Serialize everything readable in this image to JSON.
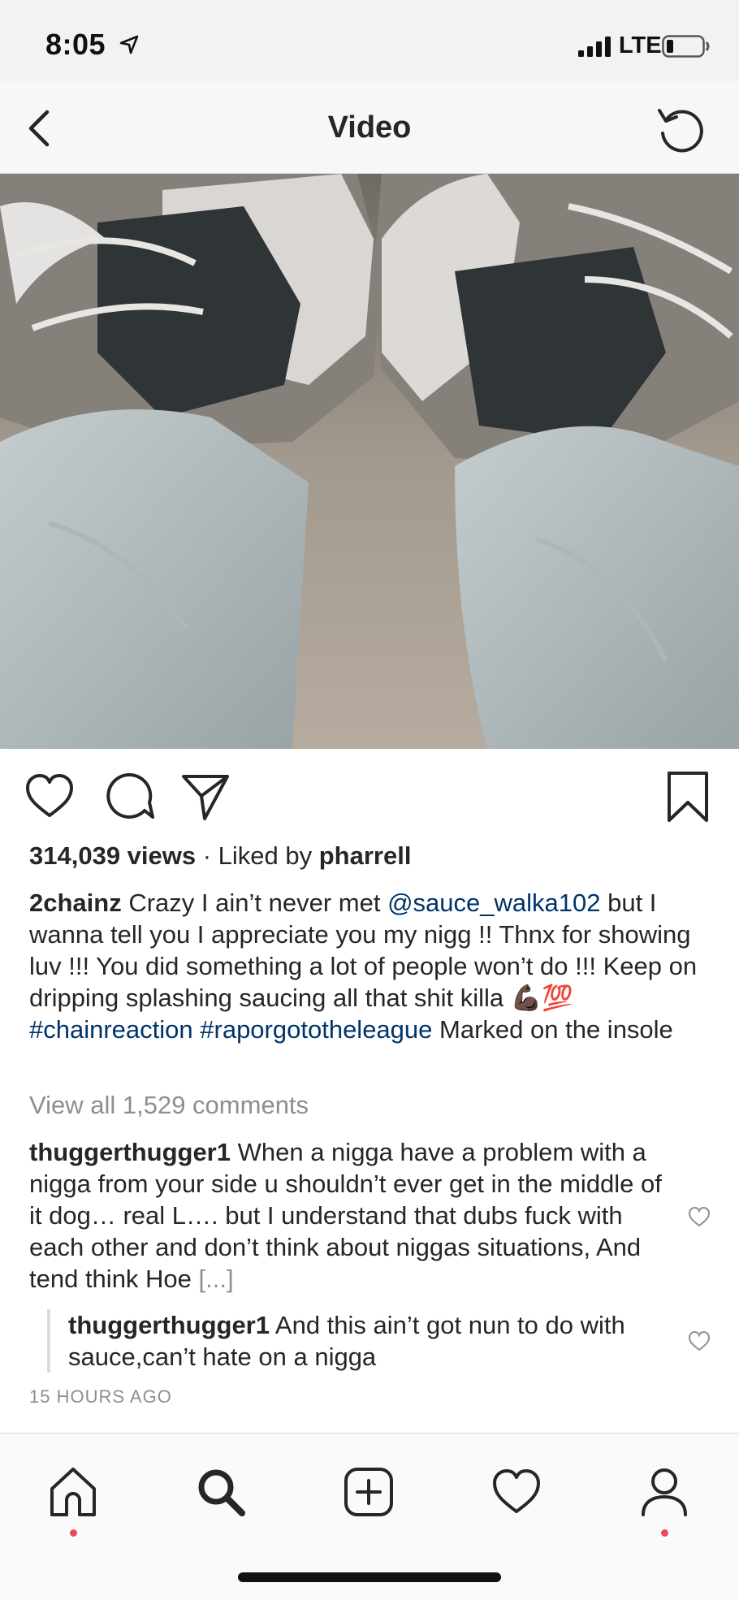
{
  "status_bar": {
    "time": "8:05",
    "network": "LTE",
    "icons": [
      "location-arrow-icon",
      "signal-bars-icon",
      "battery-icon"
    ]
  },
  "header": {
    "title": "Video",
    "back_icon": "chevron-left-icon",
    "refresh_icon": "refresh-icon"
  },
  "actions": {
    "icons": [
      "heart-icon",
      "comment-icon",
      "share-icon",
      "bookmark-icon"
    ]
  },
  "post": {
    "views": "314,039 views",
    "liked_by_prefix": " · Liked by ",
    "liked_by_user": "pharrell",
    "caption": {
      "user": "2chainz",
      "text_1": " Crazy I ain’t never met ",
      "mention": "@sauce_walka102",
      "text_2": " but I wanna tell you I appreciate you my nigg !! Thnx for showing luv !!! You did something a lot of people won’t do !!! Keep on dripping splashing saucing all that shit killa ",
      "emoji": "💪🏿💯",
      "hashtag_1": "#chainreaction",
      "hashtag_2": "#raporgototheleague",
      "text_3": " Marked on the insole"
    },
    "view_all_comments": "View all 1,529 comments",
    "comments": [
      {
        "user": "thuggerthugger1",
        "text": " When a nigga have a problem with a nigga from your side u shouldn’t ever get in the middle of it dog… real L…. but I understand that dubs fuck with each other and don’t think about niggas situations, And tend think Hoe ",
        "more": "[...]"
      },
      {
        "user": "thuggerthugger1",
        "text": " And this ain’t got nun to do with sauce,can’t hate on a nigga"
      }
    ],
    "timestamp": "15 HOURS AGO"
  },
  "tabbar": {
    "icons": [
      "home-icon",
      "search-icon",
      "new-post-icon",
      "activity-heart-icon",
      "profile-icon"
    ],
    "notification_color": "#ed4956"
  },
  "colors": {
    "link": "#003569",
    "muted": "#8e8e8e",
    "text": "#262626"
  }
}
